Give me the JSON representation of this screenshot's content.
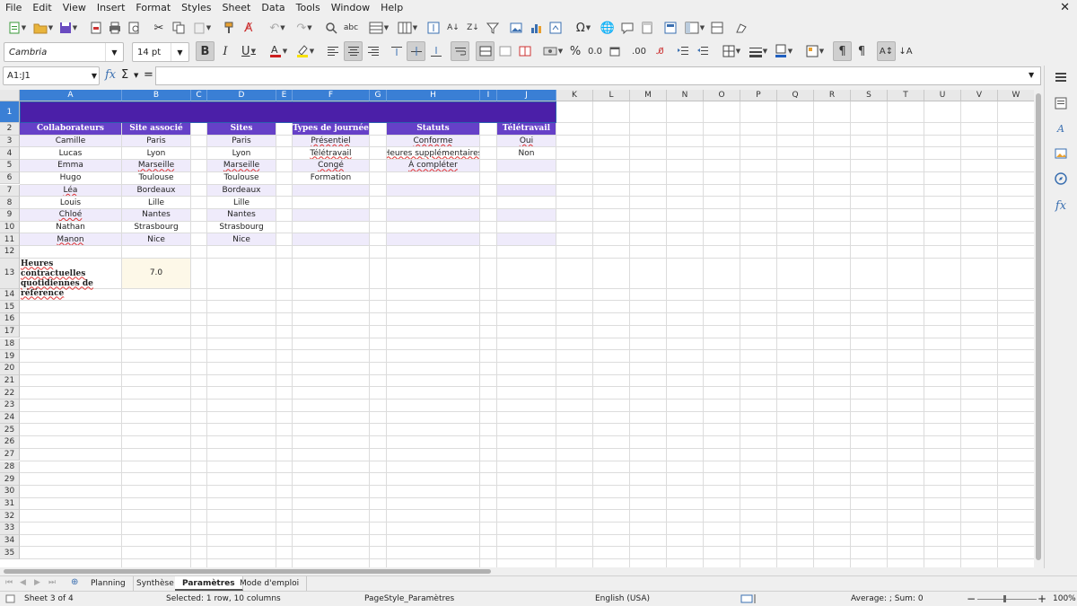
{
  "menu": {
    "items": [
      "File",
      "Edit",
      "View",
      "Insert",
      "Format",
      "Styles",
      "Sheet",
      "Data",
      "Tools",
      "Window",
      "Help"
    ]
  },
  "format_bar": {
    "font_name": "Cambria",
    "font_size": "14 pt",
    "font_color": "#cc1f1f",
    "highlight_color": "#f7e100",
    "border_color": "#1f5fc0"
  },
  "formula_bar": {
    "cell_ref": "A1:J1",
    "formula": ""
  },
  "columns": [
    "A",
    "B",
    "C",
    "D",
    "E",
    "F",
    "G",
    "H",
    "I",
    "J",
    "K",
    "L",
    "M",
    "N",
    "O",
    "P",
    "Q",
    "R",
    "S",
    "T",
    "U",
    "V",
    "W"
  ],
  "rows": [
    "1",
    "2",
    "3",
    "4",
    "5",
    "6",
    "7",
    "8",
    "9",
    "10",
    "11",
    "12",
    "13",
    "14",
    "15",
    "16",
    "17",
    "18",
    "19",
    "20",
    "21",
    "22",
    "23",
    "24",
    "25",
    "26",
    "27",
    "28",
    "29",
    "30",
    "31",
    "32",
    "33",
    "34",
    "35"
  ],
  "tables": {
    "collaborateurs": {
      "header": "Collaborateurs",
      "values": [
        "Camille",
        "Lucas",
        "Emma",
        "Hugo",
        "Léa",
        "Louis",
        "Chloé",
        "Nathan",
        "Manon"
      ]
    },
    "site_associe": {
      "header": "Site associé",
      "values": [
        "Paris",
        "Lyon",
        "Marseille",
        "Toulouse",
        "Bordeaux",
        "Lille",
        "Nantes",
        "Strasbourg",
        "Nice"
      ]
    },
    "sites": {
      "header": "Sites",
      "values": [
        "Paris",
        "Lyon",
        "Marseille",
        "Toulouse",
        "Bordeaux",
        "Lille",
        "Nantes",
        "Strasbourg",
        "Nice"
      ]
    },
    "types_journee": {
      "header": "Types de journée",
      "values": [
        "Présentiel",
        "Télétravail",
        "Congé",
        "Formation"
      ]
    },
    "statuts": {
      "header": "Statuts",
      "values": [
        "Conforme",
        "Heures supplémentaires",
        "À compléter"
      ]
    },
    "teletravail": {
      "header": "Télétravail",
      "values": [
        "Oui",
        "Non"
      ]
    }
  },
  "reference": {
    "label": "Heures contractuelles quotidiennes de référence",
    "value": "7.0"
  },
  "sheet_tabs": [
    "Planning",
    "Synthèse",
    "Paramètres",
    "Mode d'emploi"
  ],
  "active_tab": "Paramètres",
  "status": {
    "sheet": "Sheet 3 of 4",
    "selection": "Selected: 1 row, 10 columns",
    "page_style": "PageStyle_Paramètres",
    "language": "English (USA)",
    "summary": "Average: ; Sum: 0",
    "zoom": "100%"
  },
  "colors": {
    "title_band": "#4b1fa8",
    "table_header": "#6640c8",
    "band_row": "#efebfb",
    "selection": "#3a7fd5"
  }
}
